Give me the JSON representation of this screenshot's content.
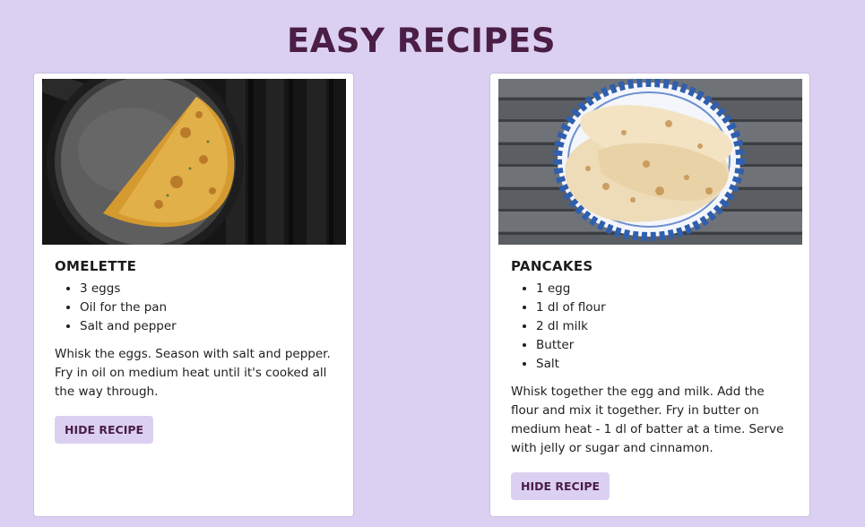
{
  "page": {
    "title": "EASY RECIPES"
  },
  "recipes": [
    {
      "title": "OMELETTE",
      "image_icon": "omelette-photo",
      "ingredients": [
        "3 eggs",
        "Oil for the pan",
        "Salt and pepper"
      ],
      "instructions": "Whisk the eggs. Season with salt and pepper. Fry in oil on medium heat until it's cooked all the way through.",
      "button_label": "HIDE RECIPE"
    },
    {
      "title": "PANCAKES",
      "image_icon": "pancakes-photo",
      "ingredients": [
        "1 egg",
        "1 dl of flour",
        "2 dl milk",
        "Butter",
        "Salt"
      ],
      "instructions": "Whisk together the egg and milk. Add the flour and mix it together. Fry in butter on medium heat - 1 dl of batter at a time. Serve with jelly or sugar and cinnamon.",
      "button_label": "HIDE RECIPE"
    }
  ],
  "colors": {
    "background": "#dcd0f2",
    "title": "#4a1e45",
    "button_bg": "#dcd0f2",
    "button_text": "#4a1e45"
  }
}
